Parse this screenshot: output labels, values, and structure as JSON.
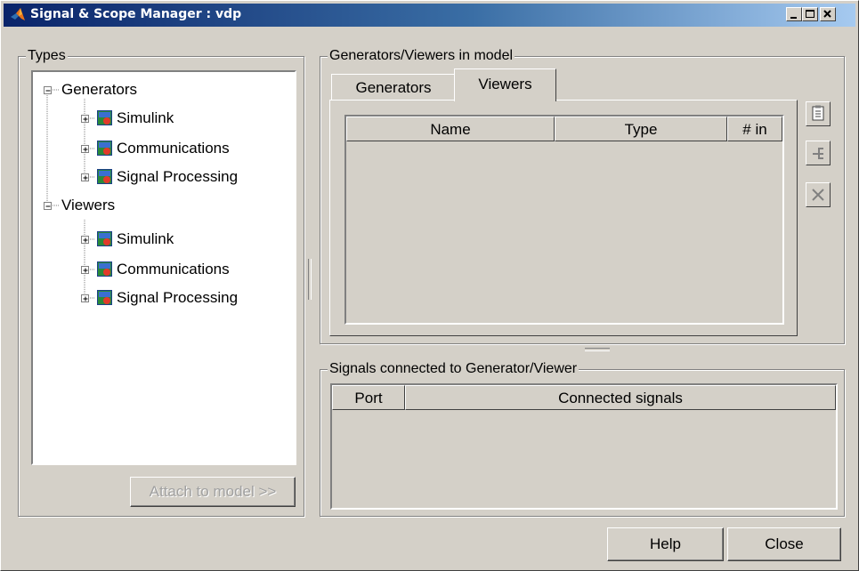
{
  "window": {
    "title": "Signal & Scope Manager : vdp",
    "app_icon": "matlab-icon",
    "controls": [
      "minimize-icon",
      "maximize-icon",
      "close-icon"
    ]
  },
  "types_panel": {
    "title": "Types",
    "tree": [
      {
        "label": "Generators",
        "expanded": true,
        "children": [
          {
            "label": "Simulink",
            "icon": "library-icon"
          },
          {
            "label": "Communications",
            "icon": "library-icon"
          },
          {
            "label": "Signal Processing",
            "icon": "library-icon"
          }
        ]
      },
      {
        "label": "Viewers",
        "expanded": true,
        "children": [
          {
            "label": "Simulink",
            "icon": "library-icon"
          },
          {
            "label": "Communications",
            "icon": "library-icon"
          },
          {
            "label": "Signal Processing",
            "icon": "library-icon"
          }
        ]
      }
    ],
    "attach_button": "Attach to model >>"
  },
  "model_panel": {
    "title": "Generators/Viewers in model",
    "tabs": [
      {
        "label": "Generators",
        "active": false
      },
      {
        "label": "Viewers",
        "active": true
      }
    ],
    "table_columns": [
      "Name",
      "Type",
      "# in"
    ],
    "table_rows": [],
    "side_buttons": [
      "properties-icon",
      "edit-signals-icon",
      "delete-icon"
    ]
  },
  "signals_panel": {
    "title": "Signals connected to Generator/Viewer",
    "table_columns": [
      "Port",
      "Connected signals"
    ],
    "table_rows": []
  },
  "footer": {
    "help_button": "Help",
    "close_button": "Close"
  }
}
